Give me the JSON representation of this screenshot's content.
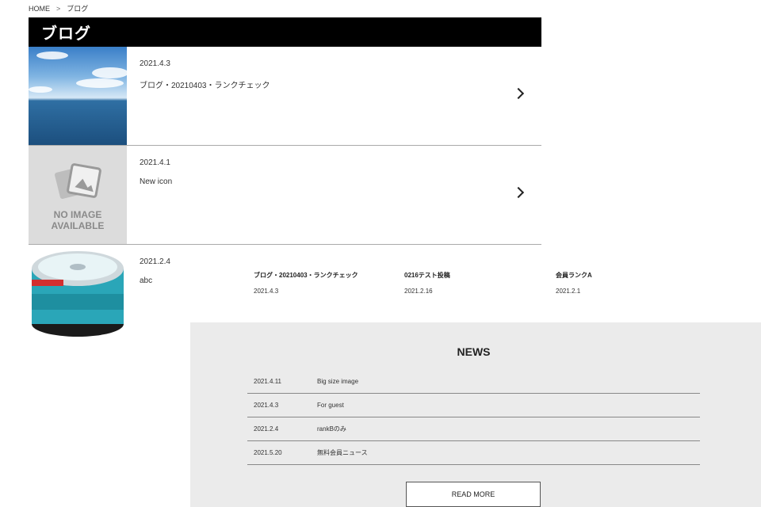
{
  "breadcrumb": {
    "home": "HOME",
    "separator": ">",
    "current": "ブログ"
  },
  "page_title": "ブログ",
  "posts": [
    {
      "date": "2021.4.3",
      "title": "ブログ・20210403・ランクチェック",
      "thumb": "sea-photo"
    },
    {
      "date": "2021.4.1",
      "title": "New icon",
      "thumb": "no-image",
      "thumb_text_1": "NO IMAGE",
      "thumb_text_2": "AVAILABLE"
    },
    {
      "date": "2021.2.4",
      "title": "abc",
      "thumb": "cd-r-spindle"
    }
  ],
  "related": [
    {
      "title": "ブログ・20210403・ランクチェック",
      "date": "2021.4.3"
    },
    {
      "title": "0216テスト投稿",
      "date": "2021.2.16"
    },
    {
      "title": "会員ランクA",
      "date": "2021.2.1"
    }
  ],
  "news": {
    "heading": "NEWS",
    "items": [
      {
        "date": "2021.4.11",
        "title": "Big size image"
      },
      {
        "date": "2021.4.3",
        "title": "For guest"
      },
      {
        "date": "2021.2.4",
        "title": "rankBのみ"
      },
      {
        "date": "2021.5.20",
        "title": "無料会員ニュース"
      }
    ],
    "read_more": "READ MORE"
  },
  "colors": {
    "title_bar": "#000000",
    "news_bg": "#ebebeb",
    "divider": "#aaaaaa"
  }
}
